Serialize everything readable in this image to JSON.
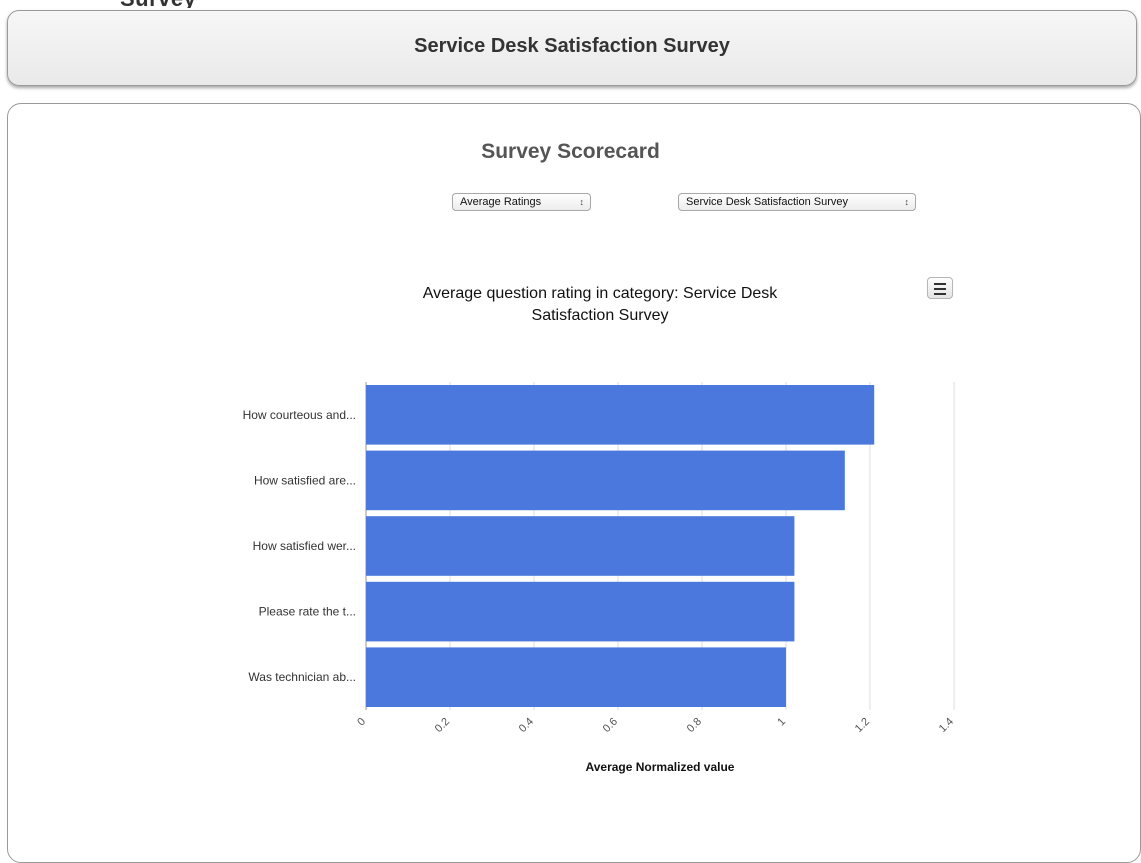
{
  "page": {
    "top_fragment_text": "Survey",
    "header_title": "Service Desk Satisfaction Survey"
  },
  "scorecard": {
    "title": "Survey Scorecard",
    "metric_select": {
      "value": "Average Ratings",
      "arrow_icon": "up-down-arrows-icon"
    },
    "survey_select": {
      "value": "Service Desk Satisfaction Survey",
      "arrow_icon": "up-down-arrows-icon"
    },
    "menu_icon": "hamburger-menu-icon"
  },
  "chart_data": {
    "type": "bar",
    "orientation": "horizontal",
    "title": "Average question rating in category: Service Desk Satisfaction Survey",
    "title_line1": "Average question rating in category: Service Desk",
    "title_line2": "Satisfaction Survey",
    "categories": [
      "How courteous and...",
      "How satisfied are...",
      "How satisfied wer...",
      "Please rate the t...",
      "Was technician ab..."
    ],
    "values": [
      1.21,
      1.14,
      1.02,
      1.02,
      1.0
    ],
    "xlabel": "Average Normalized value",
    "ylabel": "",
    "xlim": [
      0,
      1.4
    ],
    "x_ticks": [
      0,
      0.2,
      0.4,
      0.6,
      0.8,
      1,
      1.2,
      1.4
    ],
    "x_tick_labels": [
      "0",
      "0.2",
      "0.4",
      "0.6",
      "0.8",
      "1",
      "1.2",
      "1.4"
    ],
    "bar_color": "#4a78dc",
    "grid": true
  }
}
